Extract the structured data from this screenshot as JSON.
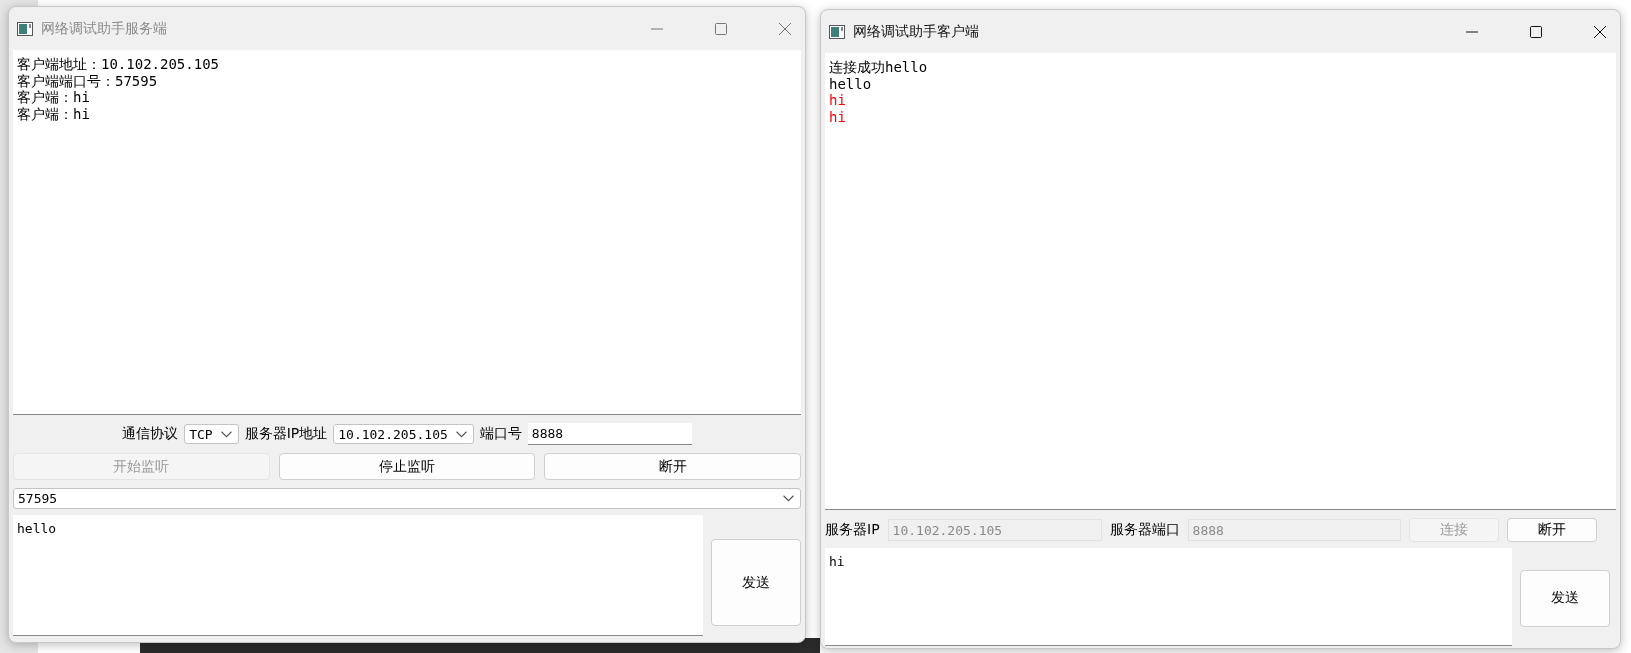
{
  "server_window": {
    "title": "网络调试助手服务端",
    "active": false,
    "log": [
      {
        "text": "客户端地址：10.102.205.105",
        "color": "#000000"
      },
      {
        "text": "客户端端口号：57595",
        "color": "#000000"
      },
      {
        "text": "客户端：hi",
        "color": "#000000"
      },
      {
        "text": "客户端：hi",
        "color": "#000000"
      }
    ],
    "protocol_label": "通信协议",
    "protocol": "TCP",
    "ip_label": "服务器IP地址",
    "ip": "10.102.205.105",
    "port_label": "端口号",
    "port": "8888",
    "buttons": [
      {
        "label": "开始监听",
        "disabled": true
      },
      {
        "label": "停止监听",
        "disabled": false
      },
      {
        "label": "断开",
        "disabled": false
      }
    ],
    "client_select": "57595",
    "message": "hello",
    "send_button": "发送"
  },
  "client_window": {
    "title": "网络调试助手客户端",
    "active": true,
    "log": [
      {
        "text": "连接成功hello",
        "color": "#000000"
      },
      {
        "text": "hello",
        "color": "#000000"
      },
      {
        "text": "hi",
        "color": "#ff0000"
      },
      {
        "text": "hi",
        "color": "#ff0000"
      }
    ],
    "ip_label": "服务器IP",
    "ip": "10.102.205.105",
    "port_label": "服务器端口",
    "port": "8888",
    "buttons": [
      {
        "label": "连接",
        "disabled": true
      },
      {
        "label": "断开",
        "disabled": false
      }
    ],
    "message": "hi",
    "send_button": "发送"
  }
}
